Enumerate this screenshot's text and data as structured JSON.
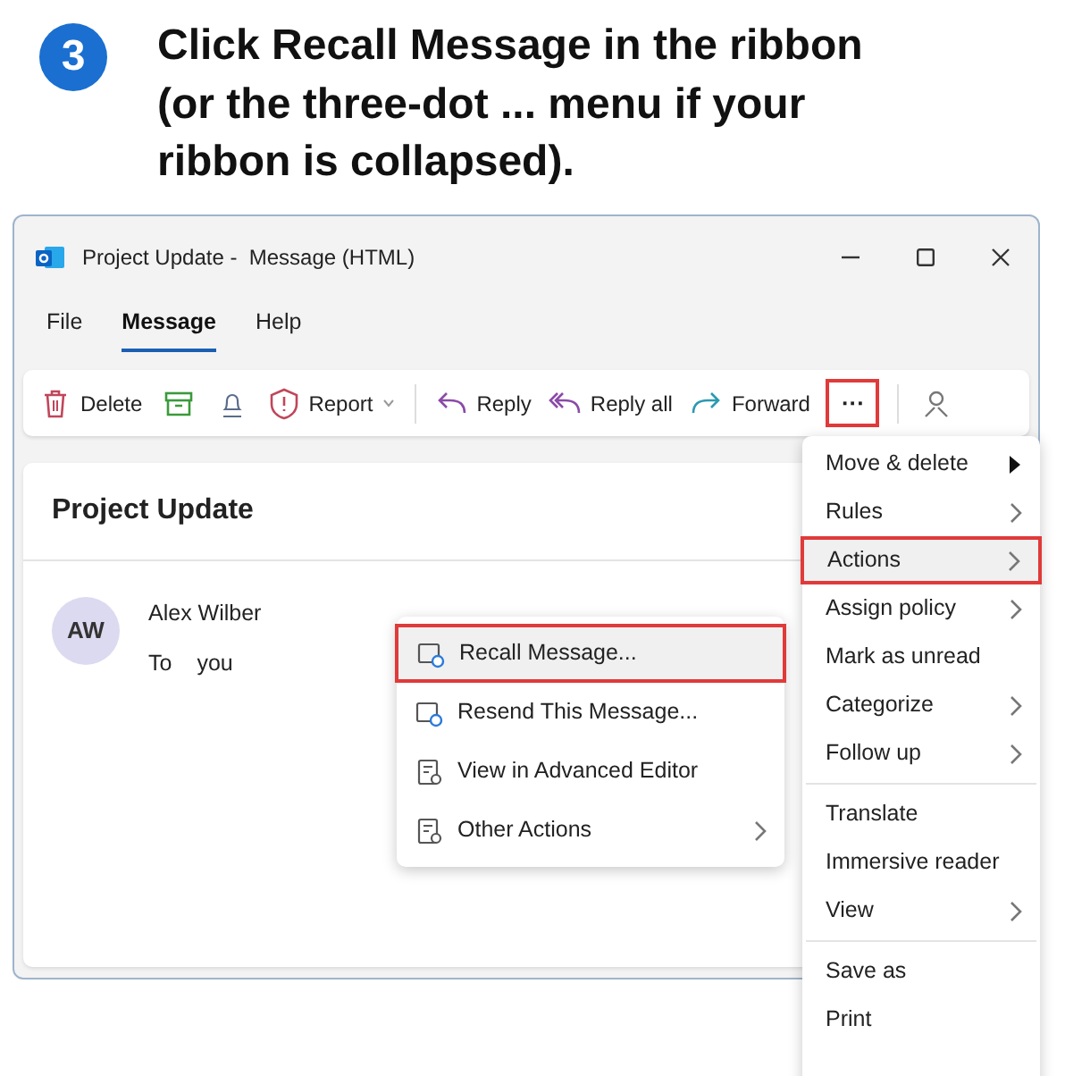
{
  "step": {
    "number": "3",
    "instruction": "Click Recall Message in the ribbon (or the three-dot ... menu if your ribbon is collapsed)."
  },
  "window": {
    "title": "Project Update -  Message (HTML)"
  },
  "tabs": [
    {
      "label": "File",
      "selected": false
    },
    {
      "label": "Message",
      "selected": true
    },
    {
      "label": "Help",
      "selected": false
    }
  ],
  "ribbon": [
    {
      "kind": "delete",
      "label": "Delete"
    },
    {
      "kind": "archive"
    },
    {
      "kind": "bell"
    },
    {
      "kind": "report",
      "label": "Report",
      "dropdown": true
    },
    {
      "kind": "separator"
    },
    {
      "kind": "reply",
      "label": "Reply"
    },
    {
      "kind": "reply-all",
      "label": "Reply all"
    },
    {
      "kind": "forward",
      "label": "Forward"
    },
    {
      "kind": "more",
      "label": "···",
      "highlighted": true
    },
    {
      "kind": "separator"
    },
    {
      "kind": "person"
    }
  ],
  "message": {
    "subject": "Project Update",
    "avatar": "AW",
    "sender": "Alex Wilber",
    "to_label": "To",
    "to": "you"
  },
  "more_menu": [
    [
      {
        "label": "Move & delete",
        "kind": "flyout",
        "highlighted": false
      },
      {
        "label": "Rules",
        "kind": "submenu",
        "highlighted": false
      },
      {
        "label": "Actions",
        "kind": "submenu",
        "highlighted": true
      },
      {
        "label": "Assign policy",
        "kind": "submenu",
        "highlighted": false
      },
      {
        "label": "Mark as unread",
        "kind": "command",
        "highlighted": false
      },
      {
        "label": "Categorize",
        "kind": "submenu",
        "highlighted": false
      },
      {
        "label": "Follow up",
        "kind": "submenu",
        "highlighted": false
      }
    ],
    [
      {
        "label": "Translate",
        "kind": "command",
        "highlighted": false
      },
      {
        "label": "Immersive reader",
        "kind": "command",
        "highlighted": false
      },
      {
        "label": "View",
        "kind": "submenu",
        "highlighted": false
      }
    ],
    [
      {
        "label": "Save as",
        "kind": "command",
        "highlighted": false
      },
      {
        "label": "Print",
        "kind": "command",
        "highlighted": false
      }
    ]
  ],
  "actions_menu": [
    {
      "label": "Recall Message...",
      "kind": "envelope",
      "submenu": false,
      "highlighted": true
    },
    {
      "label": "Resend This Message...",
      "kind": "envelope",
      "submenu": false,
      "highlighted": false
    },
    {
      "label": "View in Advanced Editor",
      "kind": "document",
      "submenu": false,
      "highlighted": false
    },
    {
      "label": "Other Actions",
      "kind": "document",
      "submenu": true,
      "highlighted": false
    }
  ]
}
